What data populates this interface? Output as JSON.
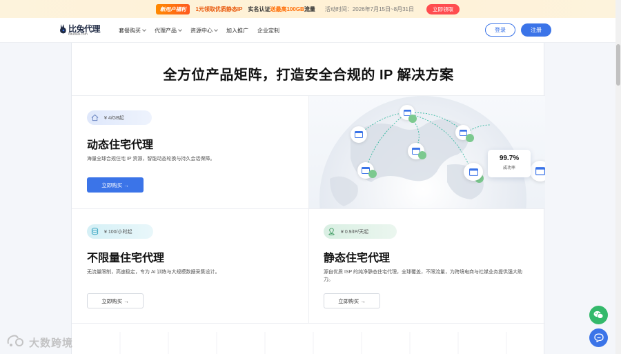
{
  "promo": {
    "tag": "新用户福利",
    "text1": "1元领取优质静态IP",
    "text2_a": "实名认证",
    "text2_b": "送最高100GB",
    "text2_c": "流量",
    "period": "活动时间：2026年7月15日~8月31日",
    "claim": "立即领取"
  },
  "nav": {
    "logo_name": "比兔代理",
    "logo_domain": "bitudaili.com",
    "menu": [
      "套餐购买",
      "代理产品",
      "资源中心",
      "加入推广",
      "企业定制"
    ],
    "login": "登录",
    "register": "注册"
  },
  "headline": "全方位产品矩阵，打造安全合规的 IP 解决方案",
  "products": {
    "dynamic": {
      "price": "¥ 4/GB起",
      "title": "动态住宅代理",
      "desc": "海量全球合规住宅 IP 资源，智能动态轮换与持久会话保障。",
      "cta": "立即购买 →"
    },
    "unlimited": {
      "price": "¥ 100/小时起",
      "title": "不限量住宅代理",
      "desc": "无流量限制，高速稳定，专为 AI 训练与大规模数据采集设计。",
      "cta": "立即购买 →"
    },
    "static": {
      "price": "¥ 0.9/IP/天起",
      "title": "静态住宅代理",
      "desc": "源自优质 ISP 的纯净静态住宅代理，全球覆盖，不限流量，为跨境电商与社媒业务提供强大助力。",
      "cta": "立即购买 →"
    }
  },
  "success": {
    "value": "99.7%",
    "label": "成功率"
  },
  "watermark": "大数跨境",
  "colors": {
    "primary": "#3b74e8",
    "promo_orange": "#ff6a00",
    "wechat_green": "#34b96b"
  }
}
